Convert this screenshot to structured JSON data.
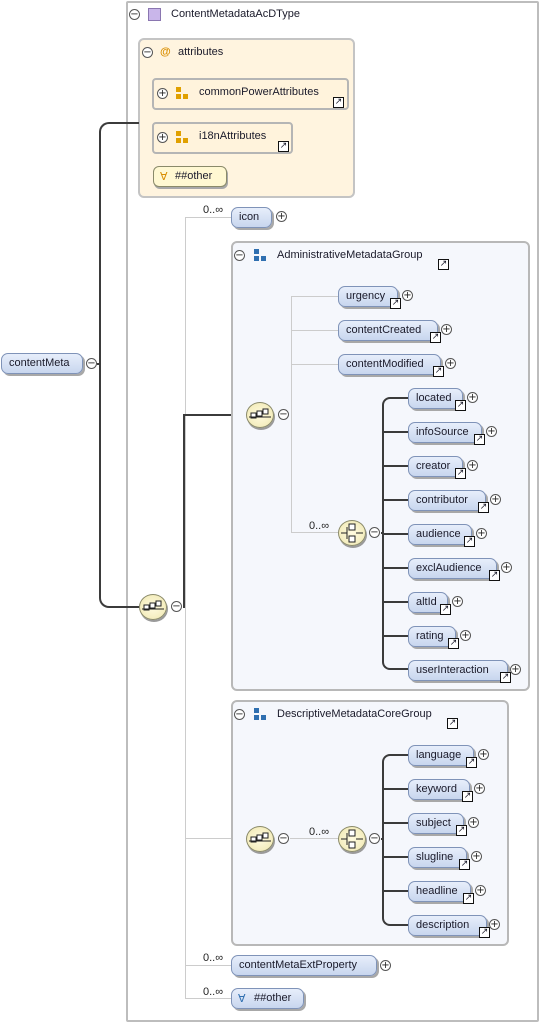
{
  "type_name": "ContentMetadataAcDType",
  "root": "contentMeta",
  "attributes_group": {
    "label": "attributes",
    "items": [
      "commonPowerAttributes",
      "i18nAttributes"
    ],
    "other": "##other"
  },
  "icon_element": {
    "label": "icon",
    "occurs": "0..∞"
  },
  "admin_group": {
    "label": "AdministrativeMetadataGroup",
    "items": [
      "urgency",
      "contentCreated",
      "contentModified"
    ],
    "choice_occurs": "0..∞",
    "choice_items": [
      "located",
      "infoSource",
      "creator",
      "contributor",
      "audience",
      "exclAudience",
      "altId",
      "rating",
      "userInteraction"
    ]
  },
  "desc_group": {
    "label": "DescriptiveMetadataCoreGroup",
    "choice_occurs": "0..∞",
    "choice_items": [
      "language",
      "keyword",
      "subject",
      "slugline",
      "headline",
      "description"
    ]
  },
  "ext_property": {
    "label": "contentMetaExtProperty",
    "occurs": "0..∞"
  },
  "any_other": {
    "label": "##other",
    "occurs": "0..∞"
  },
  "glyphs": {
    "plus": "+",
    "minus": "−",
    "link": "↗",
    "any": "∀",
    "at": "@"
  },
  "colors": {
    "element_fill": "#c8d6ee",
    "attr_fill": "#fff3dc",
    "group_fill": "#f7f9fd",
    "compositor_fill": "#efe7b0"
  }
}
